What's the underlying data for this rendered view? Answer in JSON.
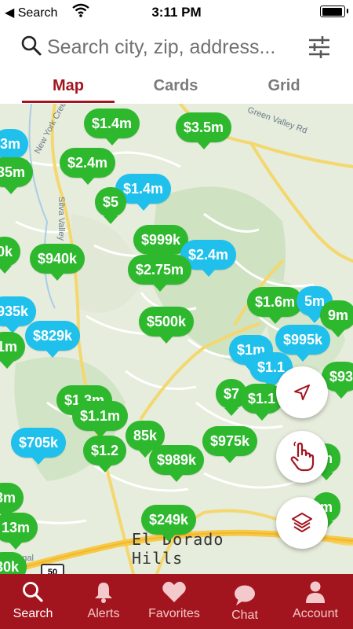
{
  "status_bar": {
    "back_label": "◀ Search",
    "time": "3:11 PM"
  },
  "search": {
    "placeholder": "Search city, zip, address..."
  },
  "tabs": [
    {
      "label": "Map",
      "active": true
    },
    {
      "label": "Cards",
      "active": false
    },
    {
      "label": "Grid",
      "active": false
    }
  ],
  "map": {
    "town_name_1": "El Dorado",
    "town_name_2": "Hills",
    "road_labels": [
      "New York Creek",
      "Silva Valley",
      "Green Valley Rd",
      "Legal"
    ],
    "highway_shield": "50",
    "pins": [
      {
        "price": "$1.4m",
        "color": "green"
      },
      {
        "price": "$3.5m",
        "color": "green"
      },
      {
        "price": "3m",
        "color": "blue"
      },
      {
        "price": "35m",
        "color": "green"
      },
      {
        "price": "$2.4m",
        "color": "green"
      },
      {
        "price": "$1.4m",
        "color": "blue"
      },
      {
        "price": "$5",
        "color": "green"
      },
      {
        "price": "$999k",
        "color": "green"
      },
      {
        "price": "0k",
        "color": "green"
      },
      {
        "price": "$940k",
        "color": "green"
      },
      {
        "price": "$2.4m",
        "color": "blue"
      },
      {
        "price": "$2.75m",
        "color": "green"
      },
      {
        "price": "$1.6m",
        "color": "green"
      },
      {
        "price": "5m",
        "color": "blue"
      },
      {
        "price": "9m",
        "color": "green"
      },
      {
        "price": "935k",
        "color": "blue"
      },
      {
        "price": "$500k",
        "color": "green"
      },
      {
        "price": "$829k",
        "color": "blue"
      },
      {
        "price": "1m",
        "color": "green"
      },
      {
        "price": "$1m",
        "color": "blue"
      },
      {
        "price": "$995k",
        "color": "blue"
      },
      {
        "price": "$1.1",
        "color": "blue"
      },
      {
        "price": "$93",
        "color": "green"
      },
      {
        "price": "$7",
        "color": "green"
      },
      {
        "price": "$1.1",
        "color": "green"
      },
      {
        "price": "$1.3m",
        "color": "green"
      },
      {
        "price": "$1.1m",
        "color": "green"
      },
      {
        "price": "85k",
        "color": "green"
      },
      {
        "price": "$705k",
        "color": "blue"
      },
      {
        "price": "$1.2",
        "color": "green"
      },
      {
        "price": "$975k",
        "color": "green"
      },
      {
        "price": "$989k",
        "color": "green"
      },
      {
        "price": "m",
        "color": "green"
      },
      {
        "price": "3m",
        "color": "green"
      },
      {
        "price": "13m",
        "color": "green"
      },
      {
        "price": "$249k",
        "color": "green"
      },
      {
        "price": "m",
        "color": "green"
      },
      {
        "price": "30k",
        "color": "green"
      }
    ]
  },
  "map_buttons": {
    "locate": "navigation-arrow-icon",
    "draw": "hand-draw-icon",
    "layers": "layers-icon"
  },
  "bottom_nav": [
    {
      "label": "Search",
      "icon": "search-icon",
      "active": true
    },
    {
      "label": "Alerts",
      "icon": "bell-icon",
      "active": false
    },
    {
      "label": "Favorites",
      "icon": "heart-icon",
      "active": false
    },
    {
      "label": "Chat",
      "icon": "chat-bubble-icon",
      "active": false
    },
    {
      "label": "Account",
      "icon": "person-icon",
      "active": false
    }
  ],
  "colors": {
    "brand": "#a3151e",
    "pin_green": "#2eb82e",
    "pin_blue": "#1fc0ec"
  }
}
